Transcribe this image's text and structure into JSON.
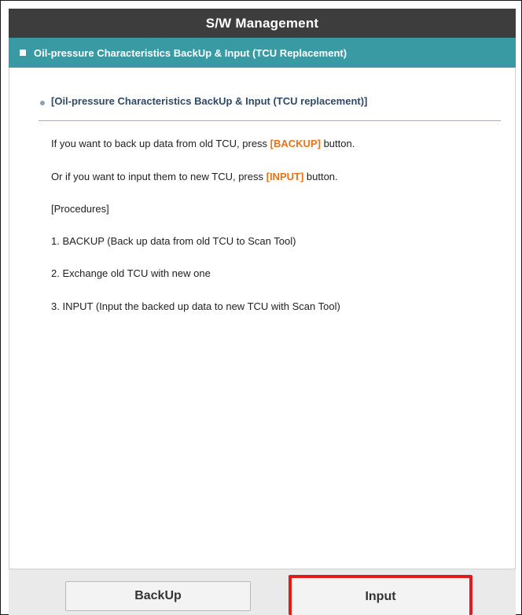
{
  "window": {
    "title": "S/W Management"
  },
  "section": {
    "title": "Oil-pressure Characteristics BackUp & Input (TCU Replacement)"
  },
  "content": {
    "heading": "[Oil-pressure Characteristics BackUp & Input (TCU replacement)]",
    "line1_prefix": "If you want to back up data from old TCU, press ",
    "line1_highlight": "[BACKUP]",
    "line1_suffix": " button.",
    "line2_prefix": "Or if you want to input them to new TCU, press ",
    "line2_highlight": "[INPUT]",
    "line2_suffix": " button.",
    "procedures_label": "[Procedures]",
    "steps": [
      "1. BACKUP (Back up data from old TCU to Scan Tool)",
      "2. Exchange old TCU with new one",
      "3. INPUT (Input the backed up data to new TCU with Scan Tool)"
    ]
  },
  "buttons": {
    "backup_label": "BackUp",
    "input_label": "Input"
  },
  "colors": {
    "title_bar": "#3d3d3d",
    "section_bar": "#3a9aa4",
    "highlight": "#e8731a",
    "selection_outline": "#e21a1a"
  }
}
